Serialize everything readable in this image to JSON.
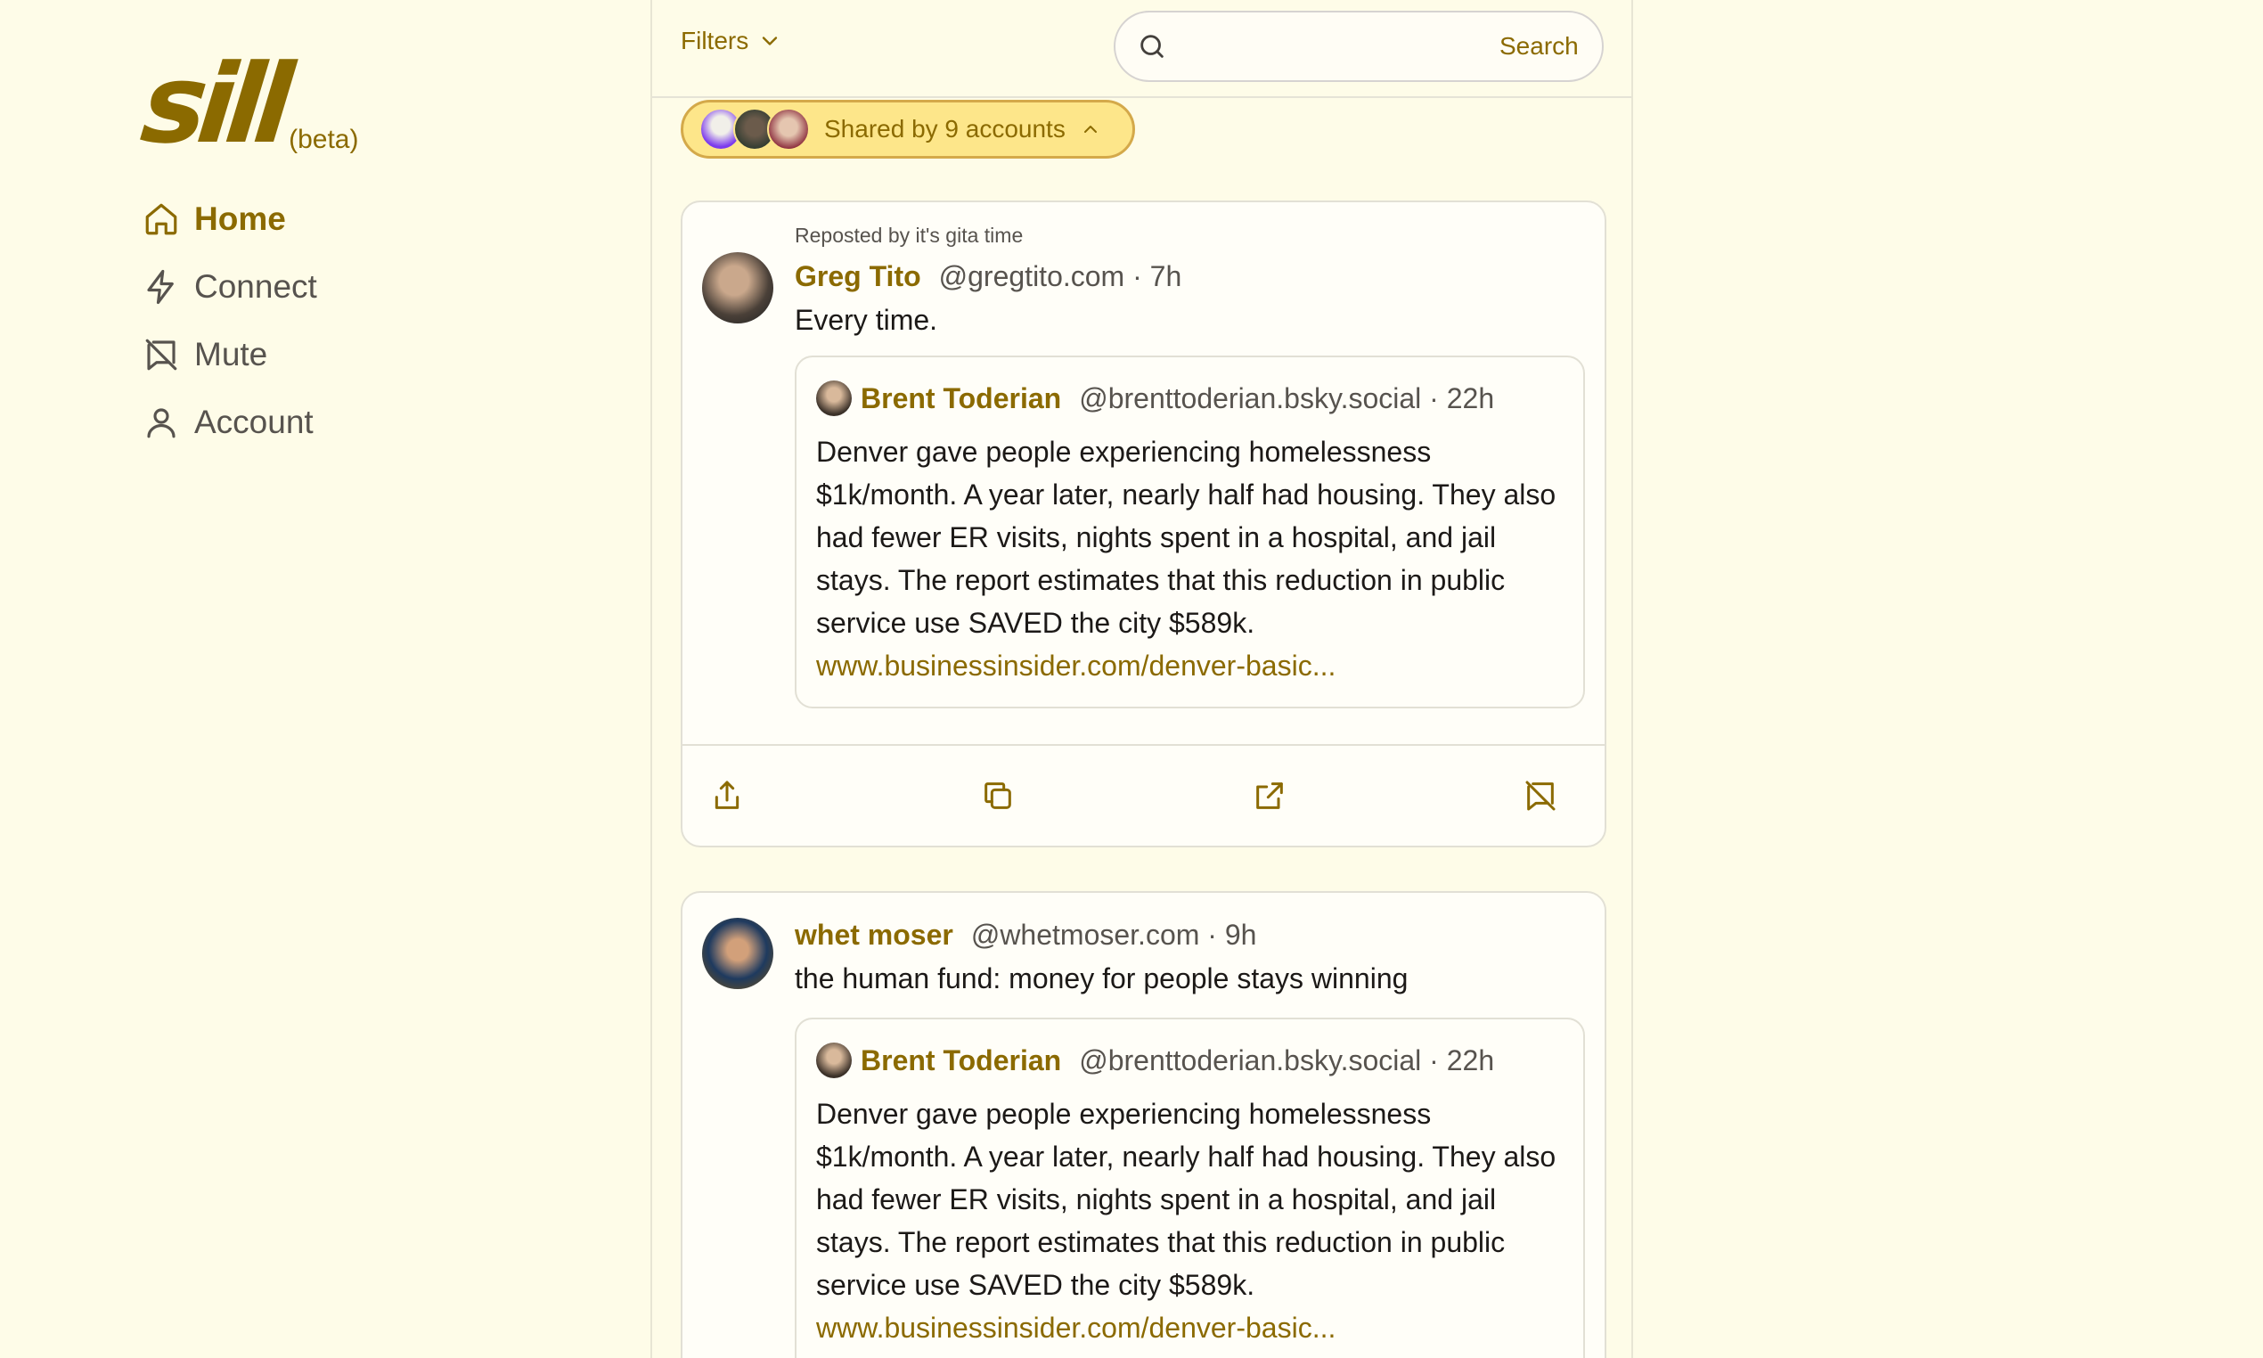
{
  "brand": {
    "logo": "sill",
    "beta": "(beta)",
    "accent_color": "#8b6a00"
  },
  "nav": [
    {
      "label": "Home",
      "icon": "home-icon",
      "active": true
    },
    {
      "label": "Connect",
      "icon": "lightning-icon",
      "active": false
    },
    {
      "label": "Mute",
      "icon": "mute-icon",
      "active": false
    },
    {
      "label": "Account",
      "icon": "user-icon",
      "active": false
    }
  ],
  "toolbar": {
    "filters_label": "Filters",
    "search_placeholder": "",
    "search_label": "Search"
  },
  "shared": {
    "label": "Shared by 9 accounts"
  },
  "posts": [
    {
      "repost_label": "Reposted by it's gita time",
      "author": "Greg Tito",
      "handle": "@gregtito.com · 7h",
      "text": "Every time.",
      "quote": {
        "author": "Brent Toderian",
        "handle": "@brenttoderian.bsky.social · 22h",
        "text": "Denver gave people experiencing homelessness $1k/month. A year later, nearly half had housing. They also had fewer ER visits, nights spent in a hospital, and jail stays. The report estimates that this reduction in public service use SAVED the city $589k.",
        "link": "www.businessinsider.com/denver-basic..."
      }
    },
    {
      "author": "whet moser",
      "handle": "@whetmoser.com · 9h",
      "text": "the human fund: money for people stays winning",
      "quote": {
        "author": "Brent Toderian",
        "handle": "@brenttoderian.bsky.social · 22h",
        "text": "Denver gave people experiencing homelessness $1k/month. A year later, nearly half had housing. They also had fewer ER visits, nights spent in a hospital, and jail stays. The report estimates that this reduction in public service use SAVED the city $589k.",
        "link": "www.businessinsider.com/denver-basic..."
      }
    }
  ],
  "actions": [
    "share-icon",
    "copy-icon",
    "external-link-icon",
    "mute-icon"
  ]
}
